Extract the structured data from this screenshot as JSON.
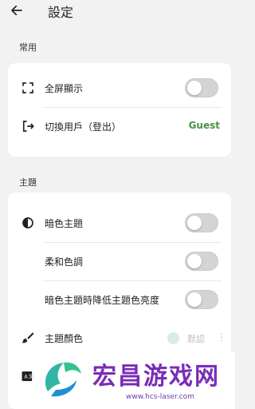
{
  "header": {
    "title": "設定"
  },
  "sections": {
    "common": {
      "title": "常用",
      "fullscreen_label": "全屏顯示",
      "switch_user_label": "切換用戶（登出）",
      "switch_user_value": "Guest"
    },
    "theme": {
      "title": "主題",
      "dark_theme_label": "暗色主題",
      "soft_tone_label": "柔和色調",
      "dim_label": "暗色主題時降低主題色亮度",
      "color_label": "主題顏色",
      "color_value": "默認",
      "color_swatch": "#d8ede3"
    }
  },
  "toggles": {
    "fullscreen": false,
    "dark_theme": false,
    "soft_tone": false,
    "dim": false
  },
  "icons": {
    "back": "arrow-left-icon",
    "fullscreen": "fullscreen-icon",
    "logout": "logout-icon",
    "contrast": "contrast-icon",
    "brush": "brush-icon",
    "translate": "translate-icon"
  },
  "watermark": {
    "text": "宏昌游戏网",
    "url": "www.hcs-laser.com"
  },
  "colors": {
    "accent": "#4c8f4c",
    "background": "#f2f2f2",
    "card": "#ffffff"
  }
}
